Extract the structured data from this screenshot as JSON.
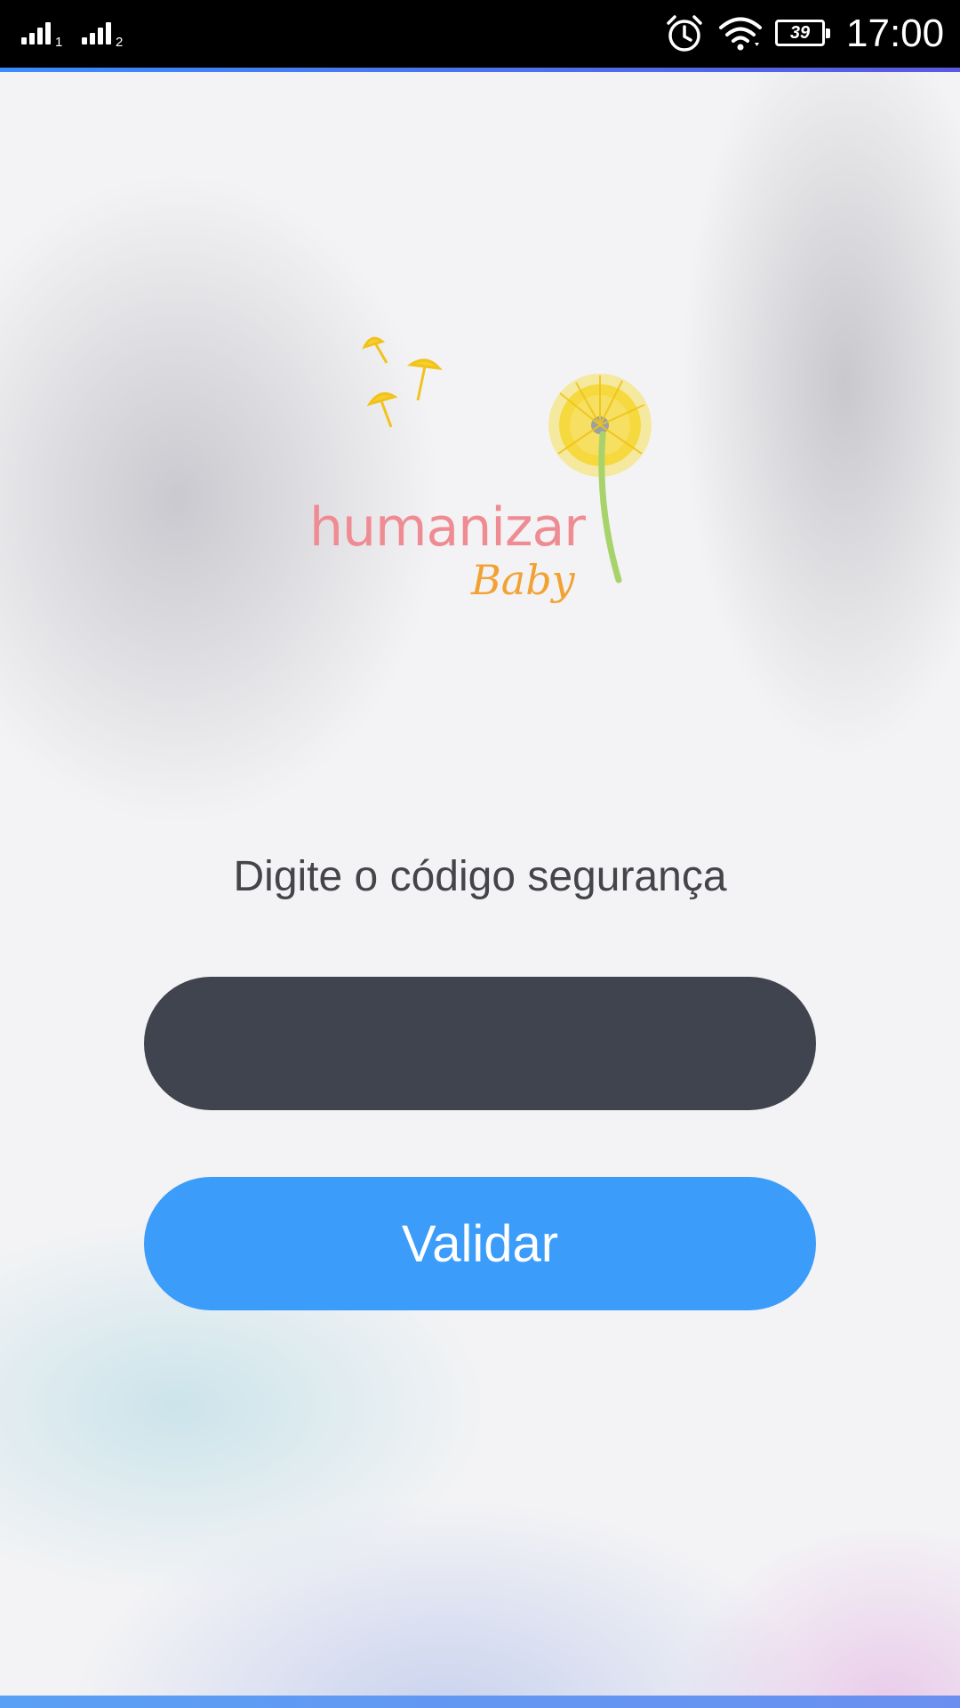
{
  "status_bar": {
    "sim1_label": "1",
    "sim2_label": "2",
    "battery_level": "39",
    "time": "17:00",
    "icons": [
      "signal-icon",
      "signal-icon",
      "alarm-icon",
      "wifi-icon",
      "battery-icon"
    ]
  },
  "logo": {
    "brand_main": "humanizar",
    "brand_sub": "Baby",
    "colors": {
      "main": "#ef8c93",
      "sub": "#f2a233",
      "flower": "#f5d31e",
      "stem": "#a8d36a"
    }
  },
  "form": {
    "prompt": "Digite o código segurança",
    "code_value": "",
    "validate_label": "Validar"
  },
  "colors": {
    "input_bg": "#40444e",
    "button_bg": "#3c9cfa",
    "text": "#44454a"
  }
}
